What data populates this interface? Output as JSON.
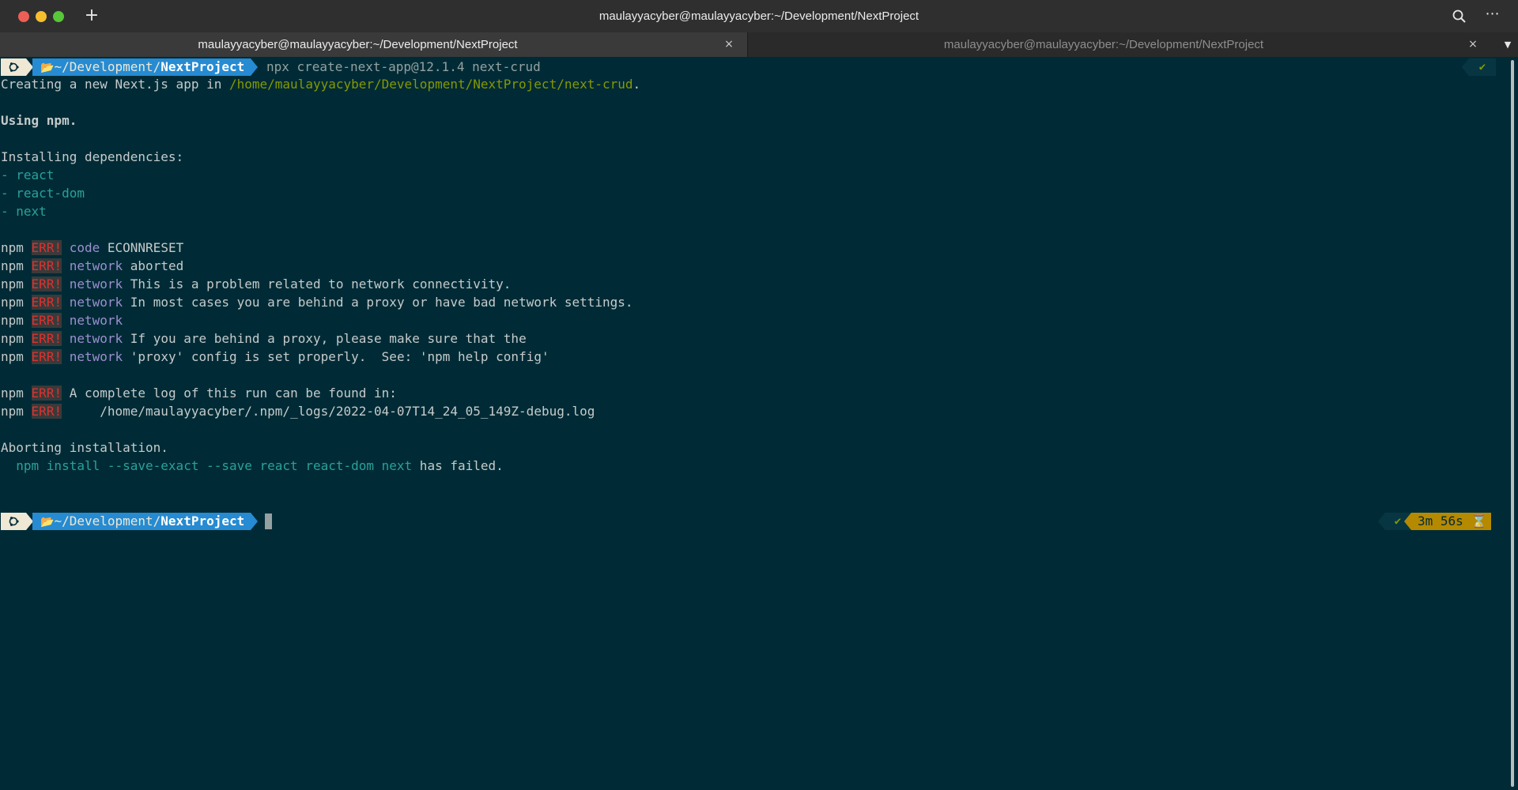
{
  "window": {
    "title": "maulayyacyber@maulayyacyber:~/Development/NextProject",
    "new_tab_label": "+",
    "menu_label": "⋯"
  },
  "tabs": [
    {
      "label": "maulayyacyber@maulayyacyber:~/Development/NextProject",
      "active": true,
      "close": "×"
    },
    {
      "label": "maulayyacyber@maulayyacyber:~/Development/NextProject",
      "active": false,
      "close": "×"
    }
  ],
  "tabs_dropdown": "▼",
  "prompt": {
    "os_icon": "ubuntu-icon",
    "folder_icon": "📂",
    "dir_prefix": "~/Development/",
    "dir_last": "NextProject",
    "command": "npx create-next-app@12.1.4 next-crud",
    "status_ok": "✔",
    "elapsed": "3m 56s",
    "hourglass": "⌛"
  },
  "output": {
    "creating_prefix": "Creating a new Next.js app in ",
    "creating_path": "/home/maulayyacyber/Development/NextProject/next-crud",
    "creating_suffix": ".",
    "using": "Using npm.",
    "installing": "Installing dependencies:",
    "deps": [
      "react",
      "react-dom",
      "next"
    ],
    "dep_bullet": "- ",
    "npm_word": "npm",
    "err_word": "ERR!",
    "errors": [
      {
        "tag": "code",
        "msg": " ECONNRESET"
      },
      {
        "tag": "network",
        "msg": " aborted"
      },
      {
        "tag": "network",
        "msg": " This is a problem related to network connectivity."
      },
      {
        "tag": "network",
        "msg": " In most cases you are behind a proxy or have bad network settings."
      },
      {
        "tag": "network",
        "msg": ""
      },
      {
        "tag": "network",
        "msg": " If you are behind a proxy, please make sure that the"
      },
      {
        "tag": "network",
        "msg": " 'proxy' config is set properly.  See: 'npm help config'"
      }
    ],
    "log_errors": [
      {
        "tag": "",
        "msg": " A complete log of this run can be found in:"
      },
      {
        "tag": "",
        "msg": "     /home/maulayyacyber/.npm/_logs/2022-04-07T14_24_05_149Z-debug.log"
      }
    ],
    "aborting": "Aborting installation.",
    "failed_cmd": "  npm install --save-exact --save react react-dom next",
    "failed_suffix": " has failed."
  },
  "colors": {
    "background": "#002b36",
    "prompt_dir": "#268bd2",
    "err": "#dc322f",
    "path_green": "#859900",
    "cyan": "#2aa198",
    "violet": "#9b8fd0",
    "elapsed_bg": "#b58900"
  }
}
